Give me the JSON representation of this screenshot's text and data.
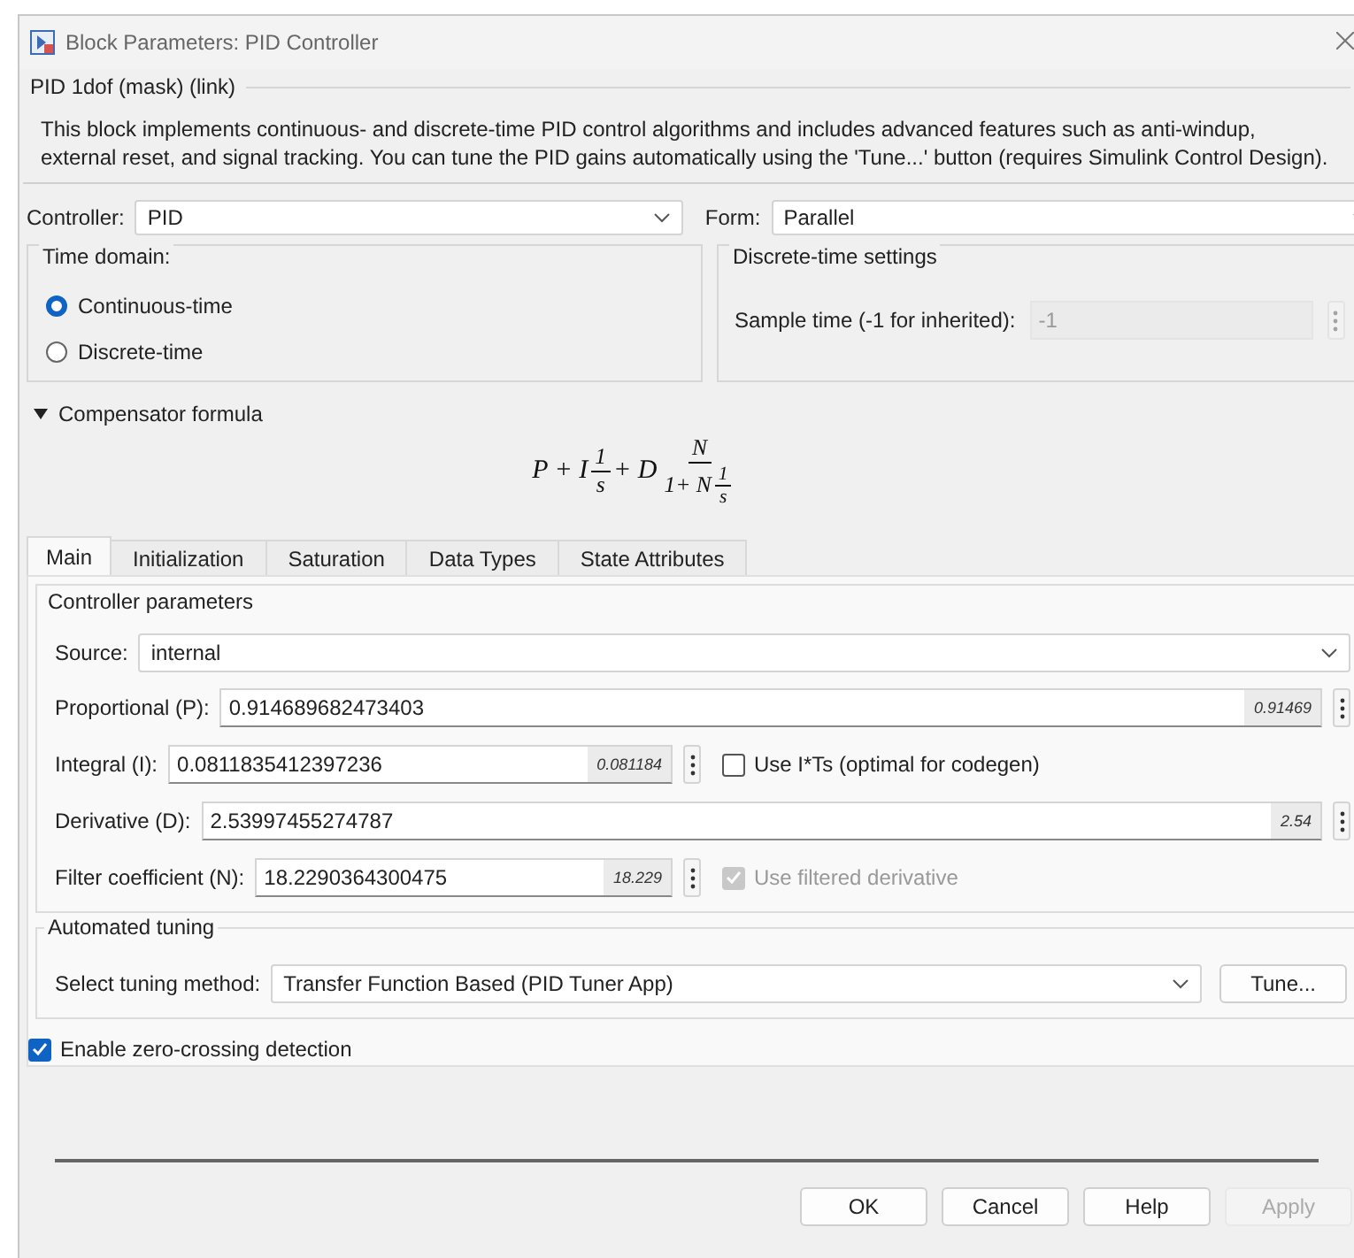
{
  "window": {
    "title": "Block Parameters: PID Controller"
  },
  "mask": {
    "header": "PID 1dof (mask) (link)",
    "description": "This block implements continuous- and discrete-time PID control algorithms and includes advanced features such as anti-windup, external reset, and signal tracking. You can tune the PID gains automatically using the 'Tune...' button (requires Simulink Control Design)."
  },
  "controller": {
    "label": "Controller:",
    "value": "PID"
  },
  "form": {
    "label": "Form:",
    "value": "Parallel"
  },
  "time_domain": {
    "title": "Time domain:",
    "options": [
      {
        "label": "Continuous-time",
        "selected": true
      },
      {
        "label": "Discrete-time",
        "selected": false
      }
    ]
  },
  "discrete_settings": {
    "title": "Discrete-time settings",
    "label": "Sample time (-1 for inherited):",
    "value": "-1",
    "disabled": true
  },
  "compensator": {
    "label": "Compensator formula",
    "expanded": true,
    "formula": [
      {
        "kind": "text",
        "text": "P + I"
      },
      {
        "kind": "frac",
        "num": [
          {
            "kind": "text",
            "text": "1"
          }
        ],
        "den": [
          {
            "kind": "text",
            "text": "s"
          }
        ]
      },
      {
        "kind": "text",
        "text": "+ D"
      },
      {
        "kind": "frac",
        "num": [
          {
            "kind": "text",
            "text": "N"
          }
        ],
        "den": [
          {
            "kind": "text",
            "text": "1+ N"
          },
          {
            "kind": "frac",
            "num": [
              {
                "kind": "text",
                "text": "1"
              }
            ],
            "den": [
              {
                "kind": "text",
                "text": "s"
              }
            ]
          }
        ]
      }
    ]
  },
  "tabs": [
    {
      "label": "Main",
      "selected": true
    },
    {
      "label": "Initialization",
      "selected": false
    },
    {
      "label": "Saturation",
      "selected": false
    },
    {
      "label": "Data Types",
      "selected": false
    },
    {
      "label": "State Attributes",
      "selected": false
    }
  ],
  "controller_parameters": {
    "title": "Controller parameters",
    "source": {
      "label": "Source:",
      "value": "internal"
    },
    "params": [
      {
        "kind": "wide",
        "label": "Proportional (P):",
        "value": "0.914689682473403",
        "preview": "0.91469"
      },
      {
        "kind": "narrow",
        "label": "Integral (I):",
        "value": "0.0811835412397236",
        "preview": "0.081184",
        "option": {
          "label": "Use I*Ts (optimal for codegen)",
          "checked": false,
          "disabled": false
        }
      },
      {
        "kind": "wide",
        "label": "Derivative (D):",
        "value": "2.53997455274787",
        "preview": "2.54"
      },
      {
        "kind": "narrow",
        "label": "Filter coefficient (N):",
        "value": "18.2290364300475",
        "preview": "18.229",
        "option": {
          "label": "Use filtered derivative",
          "checked": true,
          "disabled": true
        }
      }
    ]
  },
  "automated_tuning": {
    "title": "Automated tuning",
    "label": "Select tuning method:",
    "value": "Transfer Function Based (PID Tuner App)",
    "button": "Tune..."
  },
  "zero_crossing": {
    "label": "Enable zero-crossing detection",
    "checked": true
  },
  "buttons": [
    {
      "label": "OK",
      "disabled": false
    },
    {
      "label": "Cancel",
      "disabled": false
    },
    {
      "label": "Help",
      "disabled": false
    },
    {
      "label": "Apply",
      "disabled": true
    }
  ]
}
